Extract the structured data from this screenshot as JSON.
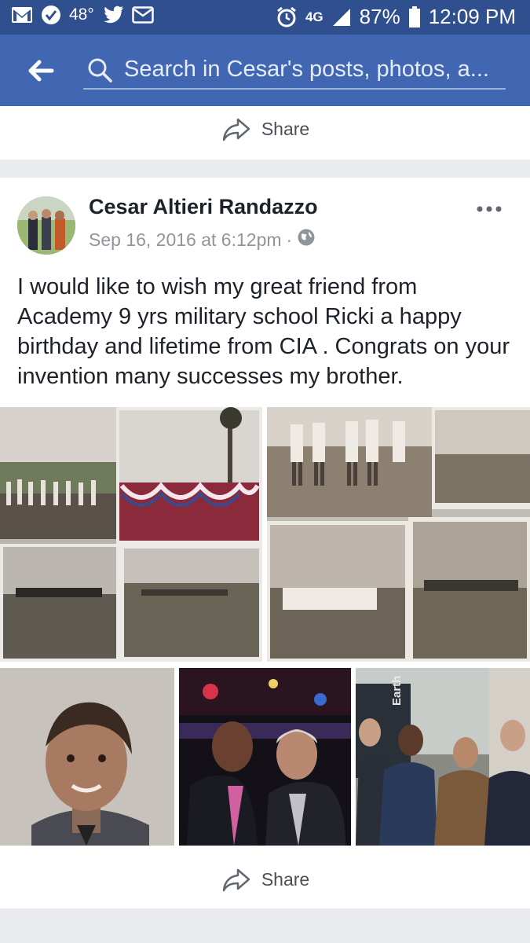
{
  "status_bar": {
    "temperature": "48°",
    "network": "4G",
    "battery": "87%",
    "time": "12:09 PM",
    "icons_left": [
      "gmail-icon",
      "check-circle-icon",
      "weather-icon",
      "twitter-icon",
      "mail-icon"
    ],
    "icons_right": [
      "alarm-icon",
      "network-icon",
      "signal-icon",
      "battery-icon"
    ]
  },
  "search": {
    "placeholder": "Search in Cesar's posts, photos, a..."
  },
  "previous_post": {
    "share_label": "Share"
  },
  "post": {
    "author": "Cesar Altieri Randazzo",
    "timestamp": "Sep 16, 2016 at 6:12pm",
    "separator": "·",
    "privacy_icon": "globe-icon",
    "text": "I would like to wish my great friend from Academy 9 yrs military school Ricki a happy birthday and lifetime from CIA . Congrats on your invention many successes my brother.",
    "photos": [
      {
        "name": "photo-military-parade-collage-1"
      },
      {
        "name": "photo-military-parade-collage-2"
      },
      {
        "name": "photo-military-parade-collage-3"
      },
      {
        "name": "photo-military-parade-collage-4"
      },
      {
        "name": "photo-boy-portrait"
      },
      {
        "name": "photo-two-men-event"
      },
      {
        "name": "photo-group-of-men"
      }
    ],
    "photo_text": "Earth",
    "share_label": "Share"
  },
  "colors": {
    "status_bar": "#2f4f8f",
    "header": "#4267b2",
    "background": "#e9ebee",
    "text_primary": "#1d2129",
    "text_secondary": "#90949c"
  }
}
